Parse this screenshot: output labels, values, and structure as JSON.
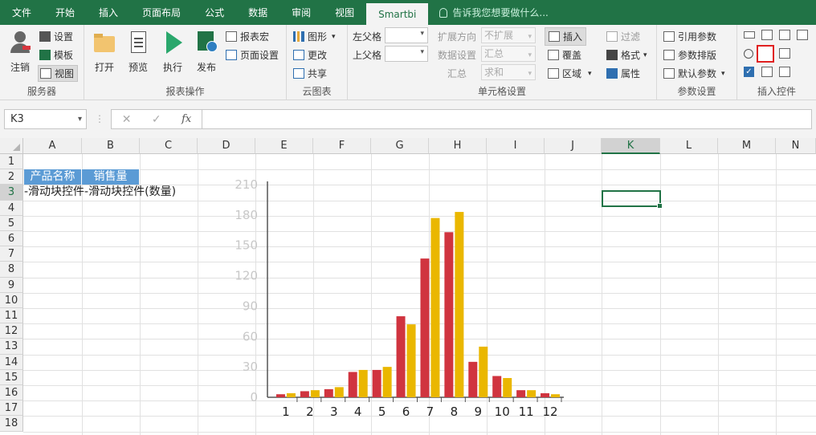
{
  "tabs": [
    "文件",
    "开始",
    "插入",
    "页面布局",
    "公式",
    "数据",
    "审阅",
    "视图",
    "Smartbi"
  ],
  "active_tab": "Smartbi",
  "tell_me": "告诉我您想要做什么...",
  "ribbon": {
    "server": {
      "label": "服务器",
      "logout": "注销",
      "settings": "设置",
      "template": "模板",
      "view": "视图"
    },
    "report_ops": {
      "label": "报表操作",
      "open": "打开",
      "preview": "预览",
      "run": "执行",
      "publish": "发布",
      "report_macro": "报表宏",
      "page_settings": "页面设置"
    },
    "cloud_chart": {
      "label": "云图表",
      "chart": "图形",
      "change": "更改",
      "share": "共享"
    },
    "cell_settings": {
      "label": "单元格设置",
      "left_parent": "左父格",
      "top_parent": "上父格",
      "expand_dir": "扩展方向",
      "expand_val": "不扩展",
      "data_setting": "数据设置",
      "data_val": "汇总",
      "summary": "汇总",
      "summary_val": "求和",
      "insert": "插入",
      "overwrite": "覆盖",
      "region": "区域"
    },
    "param_settings": {
      "label": "参数设置",
      "filter": "过滤",
      "format": "格式",
      "property": "属性",
      "ref_param": "引用参数",
      "param_layout": "参数排版",
      "default_param": "默认参数"
    },
    "insert_controls": {
      "label": "插入控件"
    }
  },
  "formula_bar": {
    "name_box": "K3",
    "fx": "fx",
    "cancel": "✕",
    "confirm": "✓",
    "formula": ""
  },
  "columns": [
    "A",
    "B",
    "C",
    "D",
    "E",
    "F",
    "G",
    "H",
    "I",
    "J",
    "K",
    "L",
    "M",
    "N"
  ],
  "selected_column": "K",
  "rows": [
    "1",
    "2",
    "3",
    "4",
    "5",
    "6",
    "7",
    "8",
    "9",
    "10",
    "11",
    "12",
    "13",
    "14",
    "15",
    "16",
    "17",
    "18"
  ],
  "cells": {
    "a2": "产品名称",
    "b2": "销售量",
    "a3": "-滑动块控件-滑动块控件(数量)"
  },
  "colors": {
    "accent": "#217346",
    "header_fill": "#5b9bd5",
    "series_red": "#d0343f",
    "series_yellow": "#eab700"
  },
  "chart_data": {
    "type": "bar",
    "categories": [
      "1",
      "2",
      "3",
      "4",
      "5",
      "6",
      "7",
      "8",
      "9",
      "10",
      "11",
      "12"
    ],
    "series": [
      {
        "values": [
          3,
          6,
          8,
          25,
          27,
          80,
          137,
          163,
          35,
          21,
          7,
          4
        ]
      },
      {
        "values": [
          4,
          7,
          10,
          27,
          30,
          72,
          177,
          183,
          50,
          19,
          7,
          3
        ]
      }
    ],
    "y_ticks": [
      "0",
      "30",
      "60",
      "90",
      "120",
      "150",
      "180",
      "210"
    ],
    "ylim": [
      0,
      210
    ],
    "grid": false,
    "legend": "none"
  }
}
